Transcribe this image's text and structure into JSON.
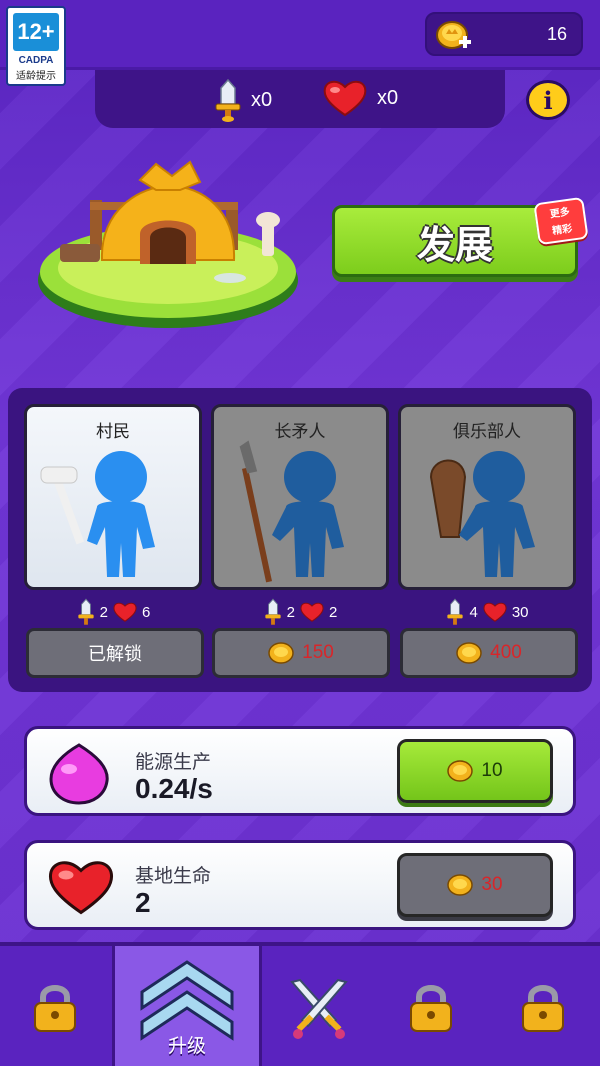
{
  "age_rating": {
    "label": "12+",
    "org": "CADPA",
    "tip": "适龄提示"
  },
  "coins": {
    "value": "16"
  },
  "stats": {
    "attack": "x0",
    "health": "x0"
  },
  "develop": {
    "label": "发展",
    "badge_line1": "更多",
    "badge_line2": "精彩"
  },
  "characters": [
    {
      "name": "村民",
      "attack": "2",
      "health": "6",
      "button": "已解锁",
      "locked": false,
      "color": "#2a8ff0"
    },
    {
      "name": "长矛人",
      "attack": "2",
      "health": "2",
      "price": "150",
      "locked": true,
      "color": "#1f5d9e"
    },
    {
      "name": "俱乐部人",
      "attack": "4",
      "health": "30",
      "price": "400",
      "locked": true,
      "color": "#1f5d9e"
    }
  ],
  "upgrades": [
    {
      "title": "能源生产",
      "value": "0.24/s",
      "price": "10",
      "enabled": true
    },
    {
      "title": "基地生命",
      "value": "2",
      "price": "30",
      "enabled": false
    }
  ],
  "nav": {
    "active_label": "升级"
  },
  "colors": {
    "background": "#6a2fd0",
    "accent_green": "#7dcd1c",
    "price_red": "#d8262a",
    "coin_gold": "#f2b21c"
  }
}
